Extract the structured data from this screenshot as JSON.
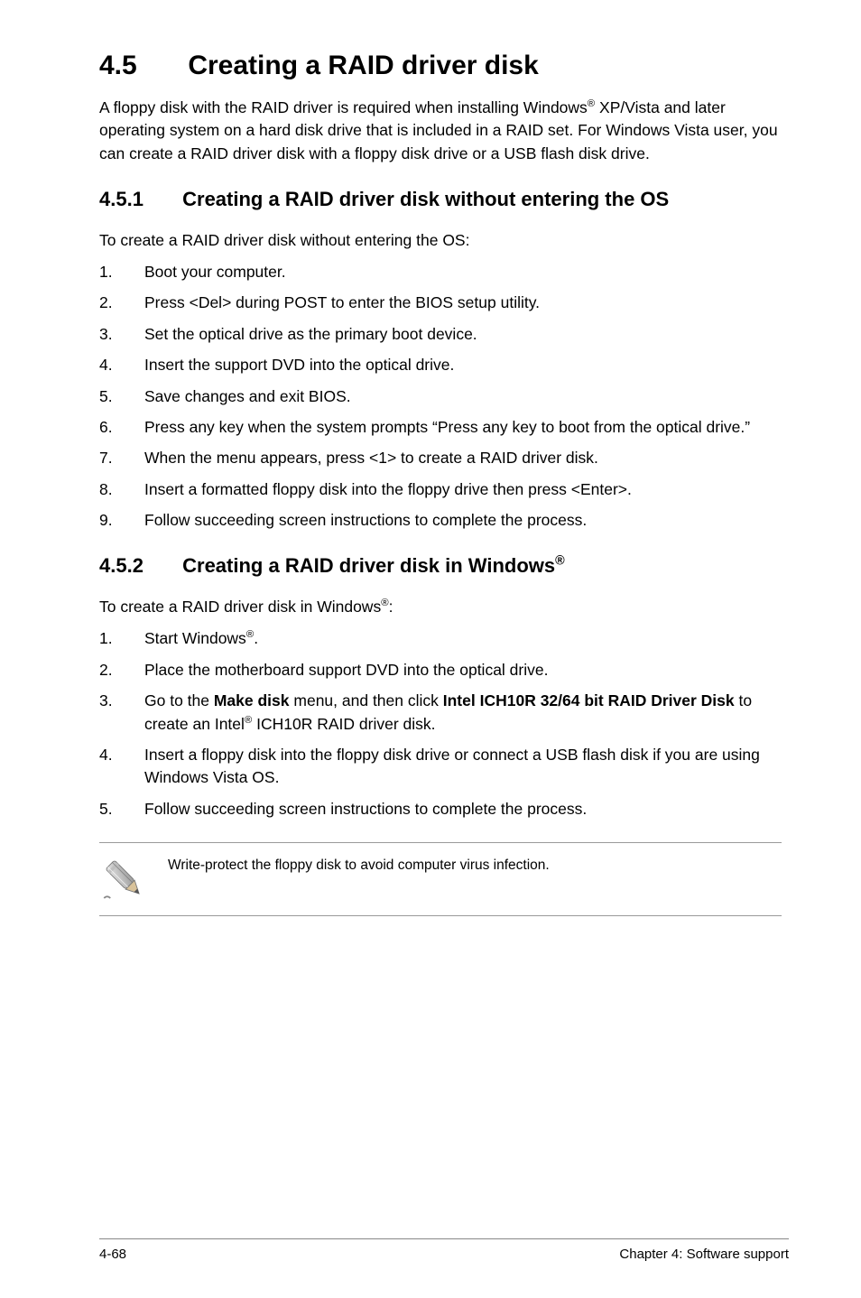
{
  "h1_num": "4.5",
  "h1_title": "Creating a RAID driver disk",
  "intro_a": "A floppy disk with the RAID driver is required when installing Windows",
  "intro_reg1": "®",
  "intro_b": " XP/Vista and later operating system on a hard disk drive that is included in a RAID set. For Windows Vista user, you can create a RAID driver disk with a floppy disk drive or a USB flash disk drive.",
  "sec1_num": "4.5.1",
  "sec1_title": "Creating a RAID driver disk without entering the OS",
  "sec1_intro": "To create a RAID driver disk without entering the OS:",
  "sec1_steps": [
    "Boot your computer.",
    "Press <Del> during POST to enter the BIOS setup utility.",
    "Set the optical drive as the primary boot device.",
    "Insert the support DVD into the optical drive.",
    "Save changes and exit BIOS.",
    "Press any key when the system prompts “Press any key to boot from the optical drive.”",
    "When the menu appears, press <1> to create a RAID driver disk.",
    "Insert a formatted floppy disk into the floppy drive then press <Enter>.",
    "Follow succeeding screen instructions to complete the process."
  ],
  "sec2_num": "4.5.2",
  "sec2_title_a": "Creating a RAID driver disk in Windows",
  "sec2_title_reg": "®",
  "sec2_intro_a": "To create a RAID driver disk in Windows",
  "sec2_intro_reg": "®",
  "sec2_intro_b": ":",
  "sec2_step1_a": "Start Windows",
  "sec2_step1_reg": "®",
  "sec2_step1_b": ".",
  "sec2_step2": "Place the motherboard support DVD into the optical drive.",
  "sec2_step3_a": "Go to the ",
  "sec2_step3_b1": "Make disk",
  "sec2_step3_c": " menu, and then click ",
  "sec2_step3_b2": "Intel ICH10R 32/64 bit RAID Driver Disk",
  "sec2_step3_d": " to create an Intel",
  "sec2_step3_reg": "®",
  "sec2_step3_e": " ICH10R RAID driver disk.",
  "sec2_step4": "Insert a floppy disk into the floppy disk drive or connect a USB flash disk if you are using Windows Vista OS.",
  "sec2_step5": "Follow succeeding screen instructions to complete the process.",
  "note_text": "Write-protect the floppy disk to avoid computer virus infection.",
  "footer_left": "4-68",
  "footer_right": "Chapter 4: Software support"
}
